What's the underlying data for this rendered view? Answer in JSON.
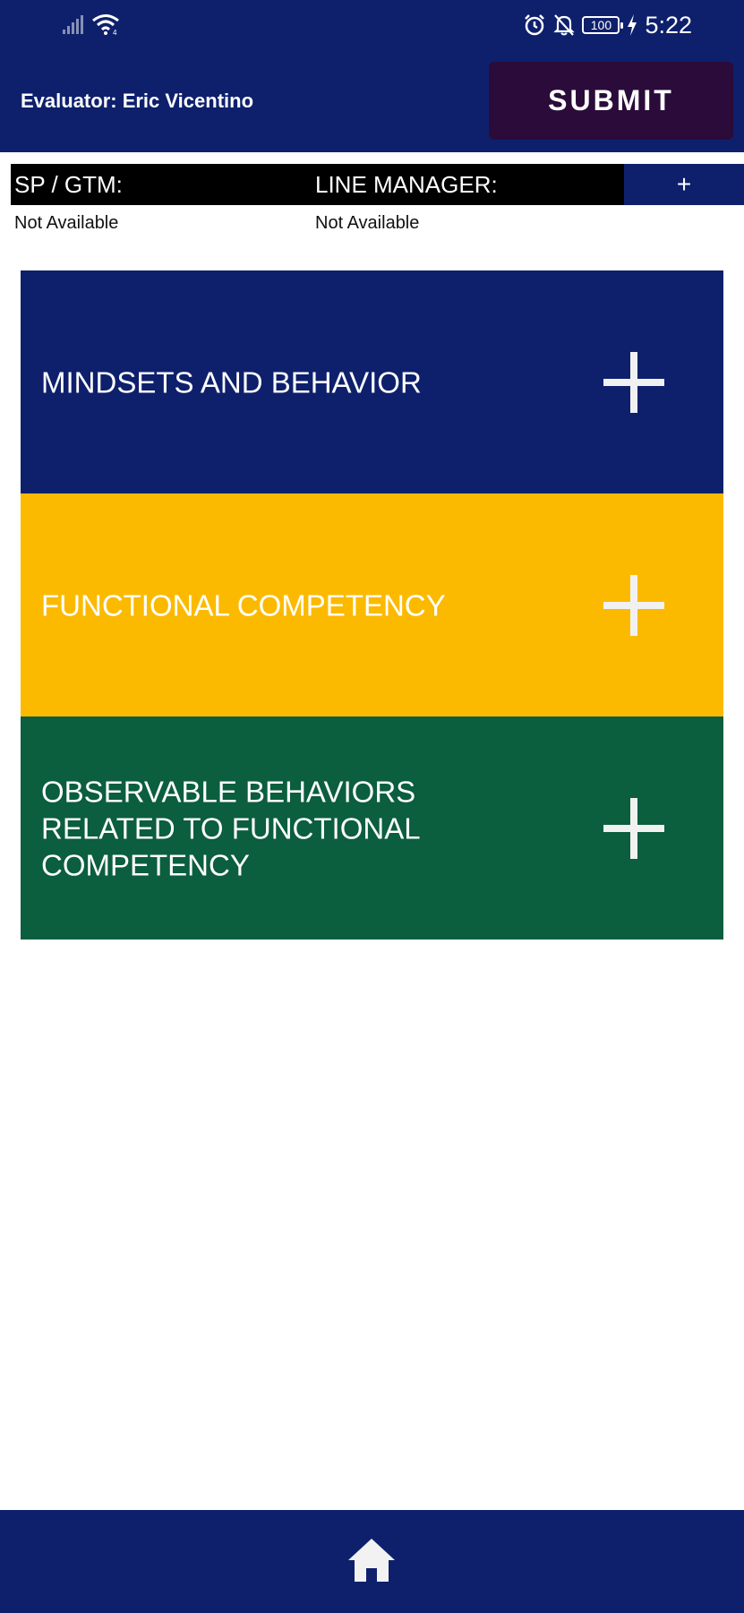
{
  "status_bar": {
    "time": "5:22",
    "battery": "100",
    "icons": [
      "signal-icon",
      "wifi-icon",
      "alarm-icon",
      "bell-off-icon",
      "battery-icon",
      "charging-icon"
    ]
  },
  "header": {
    "evaluator": "Evaluator: Eric Vicentino",
    "submit_label": "SUBMIT"
  },
  "info": {
    "sp_gtm_label": "SP / GTM:",
    "line_manager_label": "LINE MANAGER:",
    "add_label": "+",
    "sp_gtm_value": "Not Available",
    "line_manager_value": "Not Available"
  },
  "sections": [
    {
      "title": "MINDSETS AND BEHAVIOR",
      "color": "#0e206c"
    },
    {
      "title": "FUNCTIONAL COMPETENCY",
      "color": "#fbba00"
    },
    {
      "title": "OBSERVABLE BEHAVIORS RELATED TO FUNCTIONAL COMPETENCY",
      "color": "#0b5e3e"
    }
  ],
  "bottom_nav": {
    "icon": "home-icon"
  },
  "colors": {
    "navy": "#0e206c",
    "submit_bg": "#2a0b3a",
    "yellow": "#fbba00",
    "green": "#0b5e3e"
  }
}
